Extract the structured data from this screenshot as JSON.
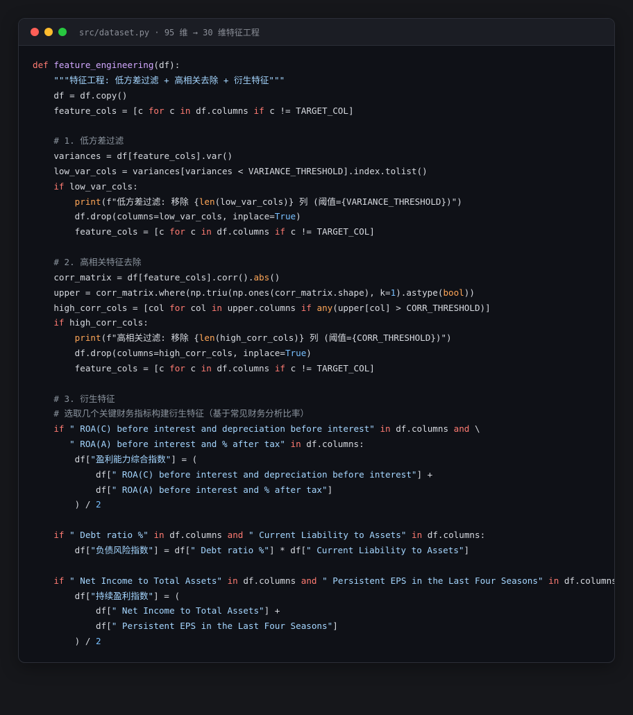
{
  "window": {
    "title": "src/dataset.py · 95 维 → 30 维特征工程"
  },
  "code": {
    "lines": [
      [
        {
          "t": "def",
          "c": "kw"
        },
        {
          "t": " "
        },
        {
          "t": "feature_engineering",
          "c": "fn"
        },
        {
          "t": "(df):"
        }
      ],
      [
        {
          "t": "    "
        },
        {
          "t": "\"\"\"特征工程: 低方差过滤 + 高相关去除 + 衍生特征\"\"\"",
          "c": "str"
        }
      ],
      [
        {
          "t": "    df = df.copy()"
        }
      ],
      [
        {
          "t": "    feature_cols = [c "
        },
        {
          "t": "for",
          "c": "kw"
        },
        {
          "t": " c "
        },
        {
          "t": "in",
          "c": "kw"
        },
        {
          "t": " df.columns "
        },
        {
          "t": "if",
          "c": "kw"
        },
        {
          "t": " c != TARGET_COL]"
        }
      ],
      [],
      [
        {
          "t": "    "
        },
        {
          "t": "# 1. 低方差过滤",
          "c": "cm"
        }
      ],
      [
        {
          "t": "    variances = df[feature_cols].var()"
        }
      ],
      [
        {
          "t": "    low_var_cols = variances[variances < VARIANCE_THRESHOLD].index.tolist()"
        }
      ],
      [
        {
          "t": "    "
        },
        {
          "t": "if",
          "c": "kw"
        },
        {
          "t": " low_var_cols:"
        }
      ],
      [
        {
          "t": "        "
        },
        {
          "t": "print",
          "c": "bi"
        },
        {
          "t": "(f\"低方差过滤: 移除 {"
        },
        {
          "t": "len",
          "c": "bi"
        },
        {
          "t": "(low_var_cols)} 列 (阈值={VARIANCE_THRESHOLD})\")"
        }
      ],
      [
        {
          "t": "        df.drop(columns=low_var_cols, inplace="
        },
        {
          "t": "True",
          "c": "cst"
        },
        {
          "t": ")"
        }
      ],
      [
        {
          "t": "        feature_cols = [c "
        },
        {
          "t": "for",
          "c": "kw"
        },
        {
          "t": " c "
        },
        {
          "t": "in",
          "c": "kw"
        },
        {
          "t": " df.columns "
        },
        {
          "t": "if",
          "c": "kw"
        },
        {
          "t": " c != TARGET_COL]"
        }
      ],
      [],
      [
        {
          "t": "    "
        },
        {
          "t": "# 2. 高相关特征去除",
          "c": "cm"
        }
      ],
      [
        {
          "t": "    corr_matrix = df[feature_cols].corr()."
        },
        {
          "t": "abs",
          "c": "bi"
        },
        {
          "t": "()"
        }
      ],
      [
        {
          "t": "    upper = corr_matrix.where(np.triu(np.ones(corr_matrix.shape), k="
        },
        {
          "t": "1",
          "c": "num"
        },
        {
          "t": ").astype("
        },
        {
          "t": "bool",
          "c": "bi"
        },
        {
          "t": "))"
        }
      ],
      [
        {
          "t": "    high_corr_cols = [col "
        },
        {
          "t": "for",
          "c": "kw"
        },
        {
          "t": " col "
        },
        {
          "t": "in",
          "c": "kw"
        },
        {
          "t": " upper.columns "
        },
        {
          "t": "if",
          "c": "kw"
        },
        {
          "t": " "
        },
        {
          "t": "any",
          "c": "bi"
        },
        {
          "t": "(upper[col] > CORR_THRESHOLD)]"
        }
      ],
      [
        {
          "t": "    "
        },
        {
          "t": "if",
          "c": "kw"
        },
        {
          "t": " high_corr_cols:"
        }
      ],
      [
        {
          "t": "        "
        },
        {
          "t": "print",
          "c": "bi"
        },
        {
          "t": "(f\"高相关过滤: 移除 {"
        },
        {
          "t": "len",
          "c": "bi"
        },
        {
          "t": "(high_corr_cols)} 列 (阈值={CORR_THRESHOLD})\")"
        }
      ],
      [
        {
          "t": "        df.drop(columns=high_corr_cols, inplace="
        },
        {
          "t": "True",
          "c": "cst"
        },
        {
          "t": ")"
        }
      ],
      [
        {
          "t": "        feature_cols = [c "
        },
        {
          "t": "for",
          "c": "kw"
        },
        {
          "t": " c "
        },
        {
          "t": "in",
          "c": "kw"
        },
        {
          "t": " df.columns "
        },
        {
          "t": "if",
          "c": "kw"
        },
        {
          "t": " c != TARGET_COL]"
        }
      ],
      [],
      [
        {
          "t": "    "
        },
        {
          "t": "# 3. 衍生特征",
          "c": "cm"
        }
      ],
      [
        {
          "t": "    "
        },
        {
          "t": "# 选取几个关键财务指标构建衍生特征（基于常见财务分析比率）",
          "c": "cm"
        }
      ],
      [
        {
          "t": "    "
        },
        {
          "t": "if",
          "c": "kw"
        },
        {
          "t": " "
        },
        {
          "t": "\" ROA(C) before interest and depreciation before interest\"",
          "c": "str"
        },
        {
          "t": " "
        },
        {
          "t": "in",
          "c": "kw"
        },
        {
          "t": " df.columns "
        },
        {
          "t": "and",
          "c": "kw"
        },
        {
          "t": " \\"
        }
      ],
      [
        {
          "t": "       "
        },
        {
          "t": "\" ROA(A) before interest and % after tax\"",
          "c": "str"
        },
        {
          "t": " "
        },
        {
          "t": "in",
          "c": "kw"
        },
        {
          "t": " df.columns:"
        }
      ],
      [
        {
          "t": "        df["
        },
        {
          "t": "\"盈利能力综合指数\"",
          "c": "str"
        },
        {
          "t": "] = ("
        }
      ],
      [
        {
          "t": "            df["
        },
        {
          "t": "\" ROA(C) before interest and depreciation before interest\"",
          "c": "str"
        },
        {
          "t": "] +"
        }
      ],
      [
        {
          "t": "            df["
        },
        {
          "t": "\" ROA(A) before interest and % after tax\"",
          "c": "str"
        },
        {
          "t": "]"
        }
      ],
      [
        {
          "t": "        ) / "
        },
        {
          "t": "2",
          "c": "num"
        }
      ],
      [],
      [
        {
          "t": "    "
        },
        {
          "t": "if",
          "c": "kw"
        },
        {
          "t": " "
        },
        {
          "t": "\" Debt ratio %\"",
          "c": "str"
        },
        {
          "t": " "
        },
        {
          "t": "in",
          "c": "kw"
        },
        {
          "t": " df.columns "
        },
        {
          "t": "and",
          "c": "kw"
        },
        {
          "t": " "
        },
        {
          "t": "\" Current Liability to Assets\"",
          "c": "str"
        },
        {
          "t": " "
        },
        {
          "t": "in",
          "c": "kw"
        },
        {
          "t": " df.columns:"
        }
      ],
      [
        {
          "t": "        df["
        },
        {
          "t": "\"负债风险指数\"",
          "c": "str"
        },
        {
          "t": "] = df["
        },
        {
          "t": "\" Debt ratio %\"",
          "c": "str"
        },
        {
          "t": "] * df["
        },
        {
          "t": "\" Current Liability to Assets\"",
          "c": "str"
        },
        {
          "t": "]"
        }
      ],
      [],
      [
        {
          "t": "    "
        },
        {
          "t": "if",
          "c": "kw"
        },
        {
          "t": " "
        },
        {
          "t": "\" Net Income to Total Assets\"",
          "c": "str"
        },
        {
          "t": " "
        },
        {
          "t": "in",
          "c": "kw"
        },
        {
          "t": " df.columns "
        },
        {
          "t": "and",
          "c": "kw"
        },
        {
          "t": " "
        },
        {
          "t": "\" Persistent EPS in the Last Four Seasons\"",
          "c": "str"
        },
        {
          "t": " "
        },
        {
          "t": "in",
          "c": "kw"
        },
        {
          "t": " df.columns:"
        }
      ],
      [
        {
          "t": "        df["
        },
        {
          "t": "\"持续盈利指数\"",
          "c": "str"
        },
        {
          "t": "] = ("
        }
      ],
      [
        {
          "t": "            df["
        },
        {
          "t": "\" Net Income to Total Assets\"",
          "c": "str"
        },
        {
          "t": "] +"
        }
      ],
      [
        {
          "t": "            df["
        },
        {
          "t": "\" Persistent EPS in the Last Four Seasons\"",
          "c": "str"
        },
        {
          "t": "]"
        }
      ],
      [
        {
          "t": "        ) / "
        },
        {
          "t": "2",
          "c": "num"
        }
      ]
    ]
  }
}
